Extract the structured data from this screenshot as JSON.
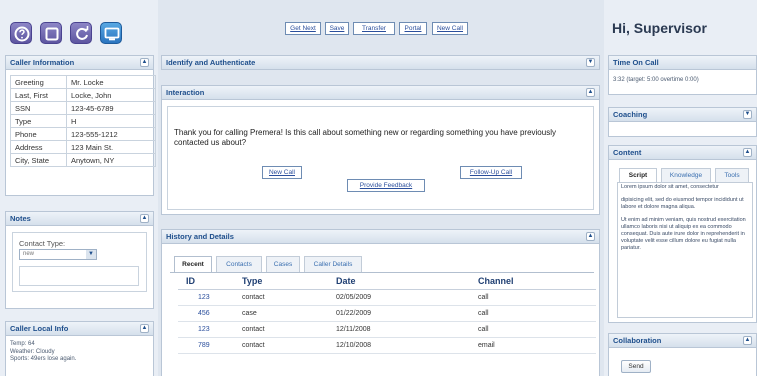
{
  "toolbar": {
    "icons": [
      "help-icon",
      "window-icon",
      "refresh-icon",
      "monitor-icon"
    ],
    "buttons": [
      "Get Next",
      "Save",
      "Transfer",
      "Portal",
      "New Call"
    ]
  },
  "caller_info": {
    "title": "Caller Information",
    "rows": [
      {
        "label": "Greeting",
        "value": "Mr. Locke"
      },
      {
        "label": "Last, First",
        "value": "Locke, John"
      },
      {
        "label": "SSN",
        "value": "123-45-6789"
      },
      {
        "label": "Type",
        "value": "H"
      },
      {
        "label": "Phone",
        "value": "123-555-1212"
      },
      {
        "label": "Address",
        "value": "123 Main St."
      },
      {
        "label": "City, State",
        "value": "Anytown, NY"
      }
    ]
  },
  "notes": {
    "title": "Notes",
    "contact_type_label": "Contact Type:",
    "contact_type_value": "new"
  },
  "caller_local": {
    "title": "Caller Local Info",
    "lines": [
      "Temp: 64",
      "Weather: Cloudy",
      "Sports: 49ers lose again."
    ]
  },
  "identify": {
    "title": "Identify and Authenticate"
  },
  "interaction": {
    "title": "Interaction",
    "prompt": "Thank you for calling Premera! Is this call about something new or regarding something you have previously contacted us about?",
    "buttons": [
      "New Call",
      "Follow-Up Call",
      "Provide Feedback"
    ]
  },
  "history": {
    "title": "History and Details",
    "tabs": [
      "Recent",
      "Contacts",
      "Cases",
      "Caller Details"
    ],
    "columns": [
      "ID",
      "Type",
      "Date",
      "Channel"
    ],
    "rows": [
      {
        "id": "123",
        "type": "contact",
        "date": "02/05/2009",
        "channel": "call"
      },
      {
        "id": "456",
        "type": "case",
        "date": "01/22/2009",
        "channel": "call"
      },
      {
        "id": "123",
        "type": "contact",
        "date": "12/11/2008",
        "channel": "call"
      },
      {
        "id": "789",
        "type": "contact",
        "date": "12/10/2008",
        "channel": "email"
      }
    ]
  },
  "right": {
    "greeting": "Hi, Supervisor",
    "time_title": "Time On Call",
    "time_text": "3:32 (target: 5:00 overtime 0:00)",
    "coaching_title": "Coaching",
    "content_title": "Content",
    "content_tabs": [
      "Script",
      "Knowledge",
      "Tools"
    ],
    "content_paragraphs": [
      "Lorem ipsum dolor sit amet, consectetur",
      "dipisicing elit, sed do eiusmod tempor incididunt ut labore et dolore magna aliqua.",
      "Ut enim ad minim veniam, quis nostrud exercitation ullamco laboris nisi ut aliquip ex ea commodo consequat. Duis aute irure dolor in reprehenderit in voluptate velit esse cillum dolore eu fugiat nulla pariatur."
    ],
    "collab_title": "Collaboration",
    "send_label": "Send"
  }
}
